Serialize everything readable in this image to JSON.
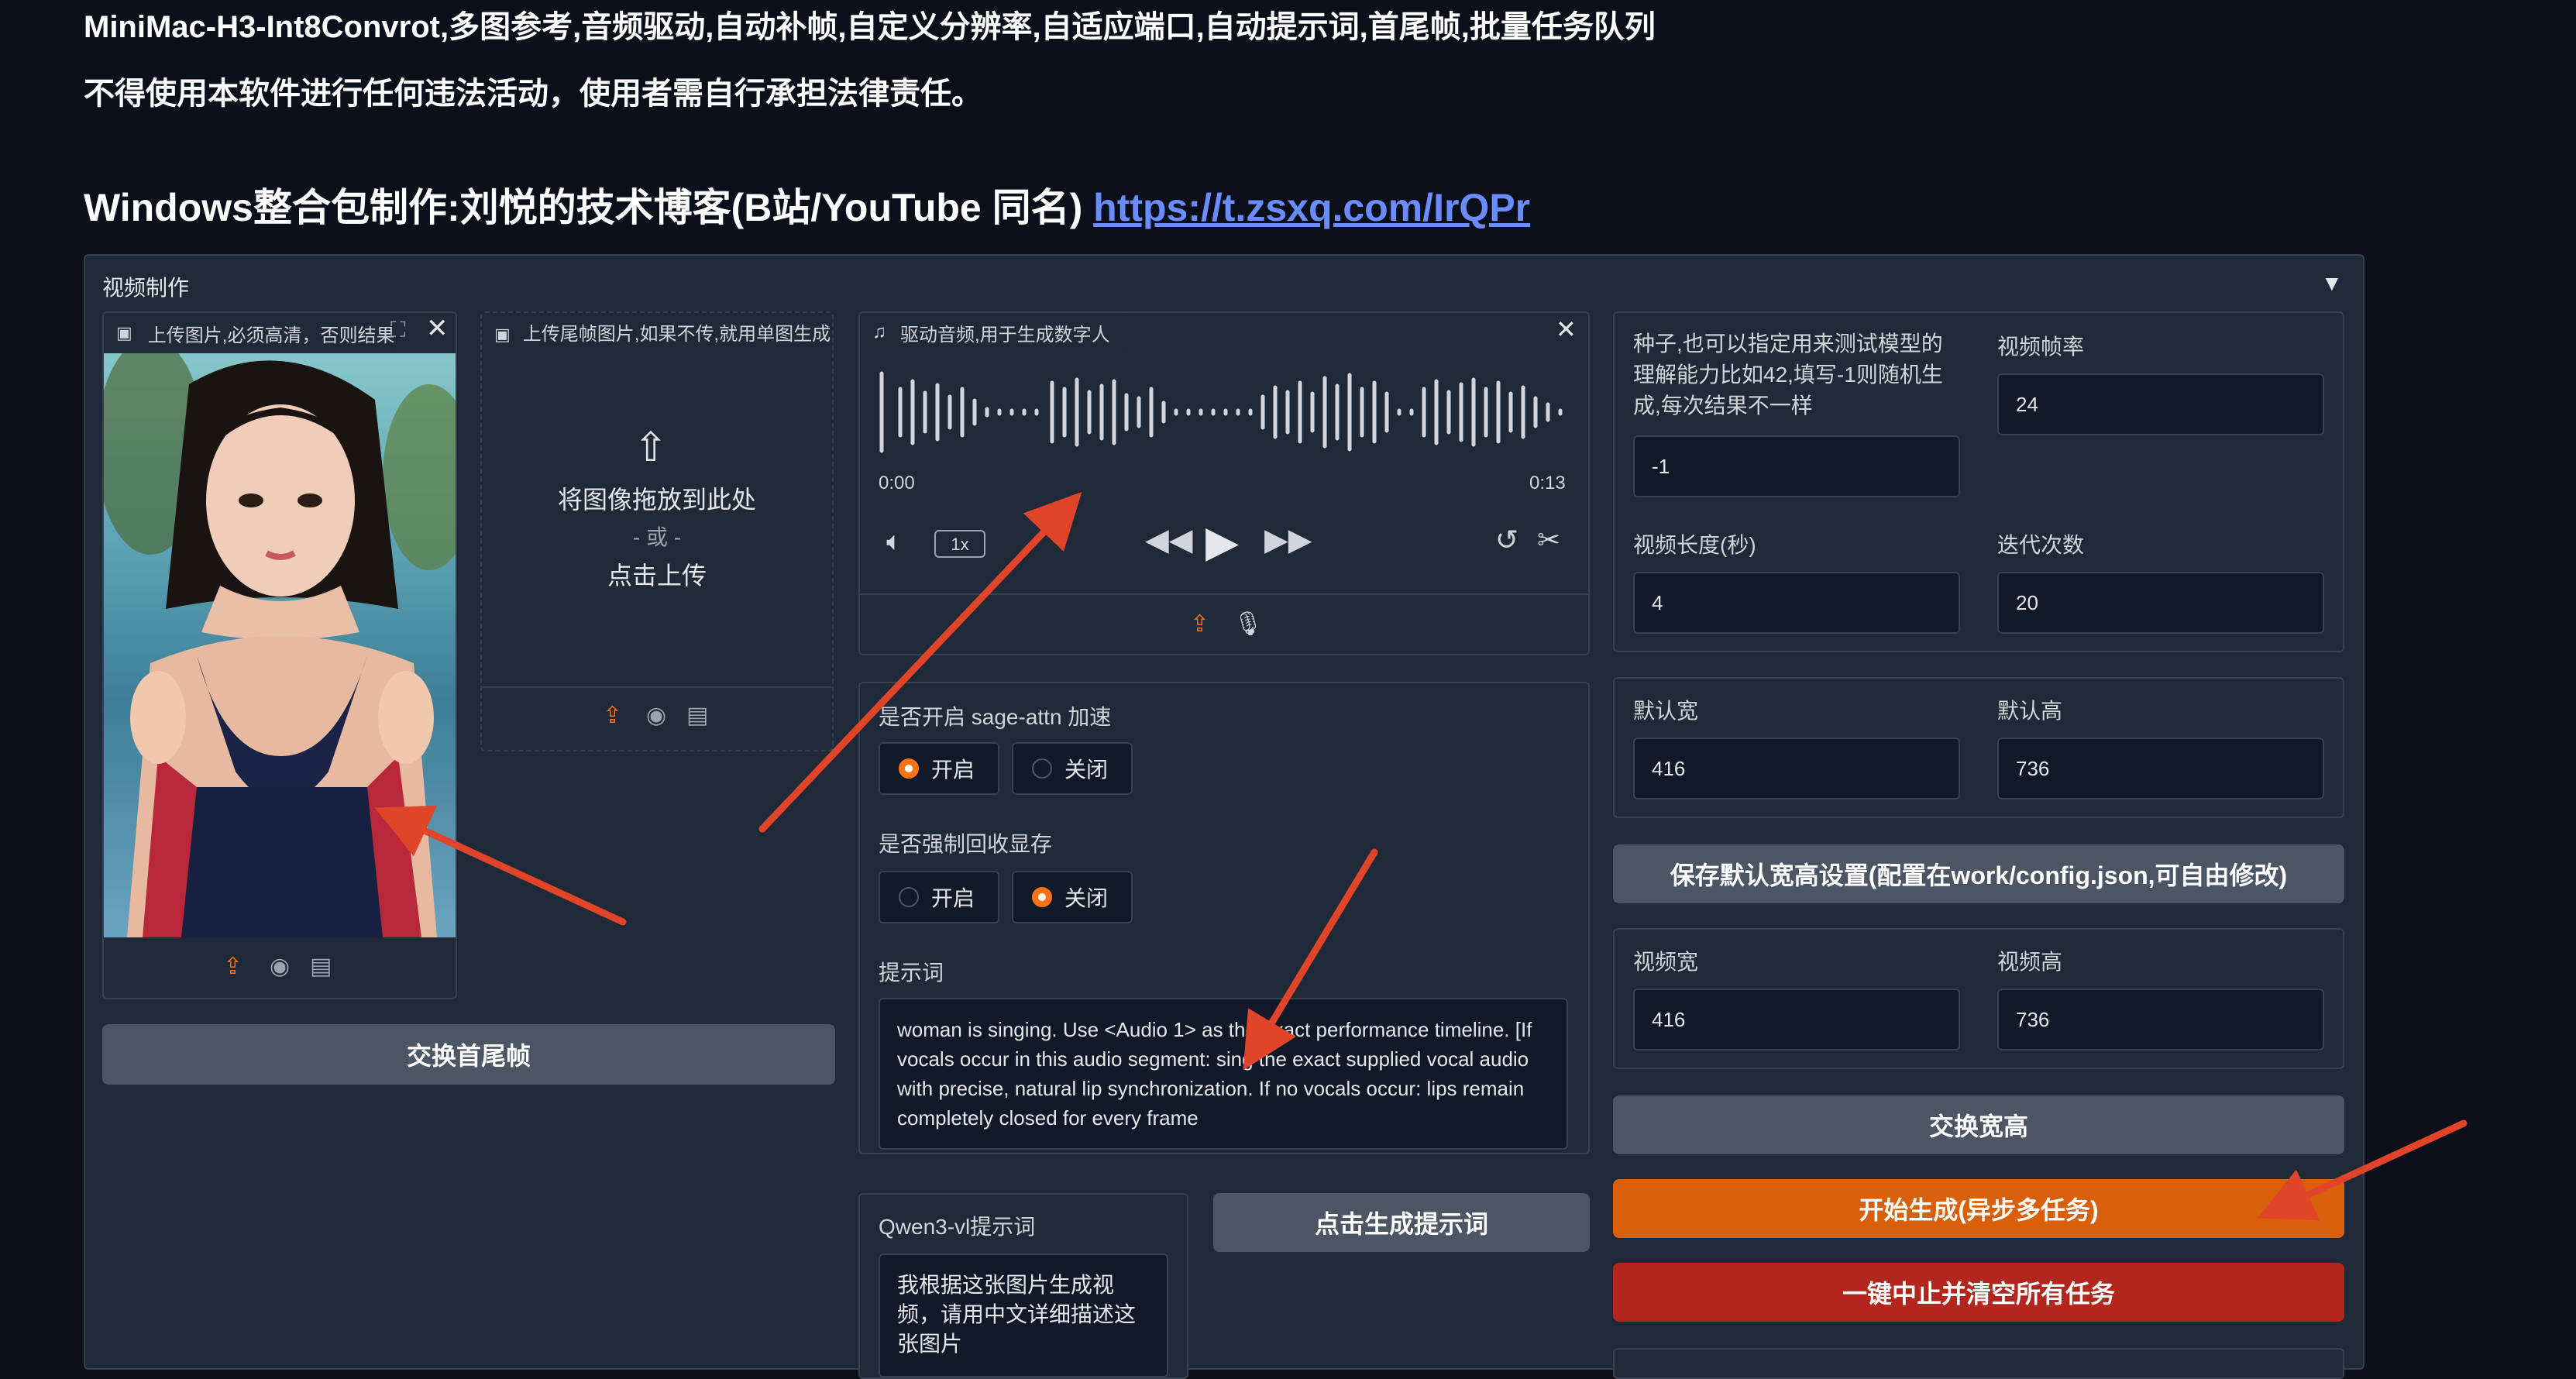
{
  "header": {
    "line1": "MiniMac-H3-Int8Convrot,多图参考,音频驱动,自动补帧,自定义分辨率,自适应端口,自动提示词,首尾帧,批量任务队列",
    "line2": "不得使用本软件进行任何违法活动，使用者需自行承担法律责任。",
    "line3_prefix": "Windows整合包制作:刘悦的技术博客(B站/YouTube 同名) ",
    "line3_link": "https://t.zsxq.com/IrQPr"
  },
  "section": {
    "title": "视频制作",
    "collapse_icon": "triangle-down-icon"
  },
  "upload_first": {
    "label": "上传图片,必须高清，否则结果",
    "image_alt": "woman in navy swimsuit by pool"
  },
  "upload_last": {
    "label": "上传尾帧图片,如果不传,就用单图生成",
    "drop_text": "将图像拖放到此处",
    "or_text": "- 或 -",
    "click_text": "点击上传"
  },
  "swap_frames_button": "交换首尾帧",
  "audio": {
    "label": "驱动音频,用于生成数字人",
    "time_start": "0:00",
    "time_end": "0:13",
    "speed": "1x"
  },
  "sage_attn": {
    "label": "是否开启 sage-attn 加速",
    "options": [
      "开启",
      "关闭"
    ],
    "selected": "开启"
  },
  "force_vram": {
    "label": "是否强制回收显存",
    "options": [
      "开启",
      "关闭"
    ],
    "selected": "关闭"
  },
  "prompt": {
    "label": "提示词",
    "value": "woman is singing. Use <Audio 1> as the exact performance timeline. [If vocals occur in this audio segment: sing the exact supplied vocal audio with precise, natural lip synchronization. If no vocals occur: lips remain completely closed for every frame"
  },
  "qwen": {
    "label": "Qwen3-vl提示词",
    "value": "我根据这张图片生成视频，请用中文详细描述这张图片"
  },
  "gen_prompt_button": "点击生成提示词",
  "seed": {
    "label": "种子,也可以指定用来测试模型的理解能力比如42,填写-1则随机生成,每次结果不一样",
    "value": "-1"
  },
  "fps": {
    "label": "视频帧率",
    "value": "24"
  },
  "duration": {
    "label": "视频长度(秒)",
    "value": "4"
  },
  "steps": {
    "label": "迭代次数",
    "value": "20"
  },
  "default_width": {
    "label": "默认宽",
    "value": "416"
  },
  "default_height": {
    "label": "默认高",
    "value": "736"
  },
  "save_defaults_button": "保存默认宽高设置(配置在work/config.json,可自由修改)",
  "video_width": {
    "label": "视频宽",
    "value": "416"
  },
  "video_height": {
    "label": "视频高",
    "value": "736"
  },
  "swap_wh_button": "交换宽高",
  "start_button": "开始生成(异步多任务)",
  "stop_button": "一键中止并清空所有任务",
  "colors": {
    "accent": "#f97316",
    "start": "#d9600a",
    "stop": "#b3261e",
    "link": "#6b8cff",
    "arrow": "#e0452a"
  }
}
